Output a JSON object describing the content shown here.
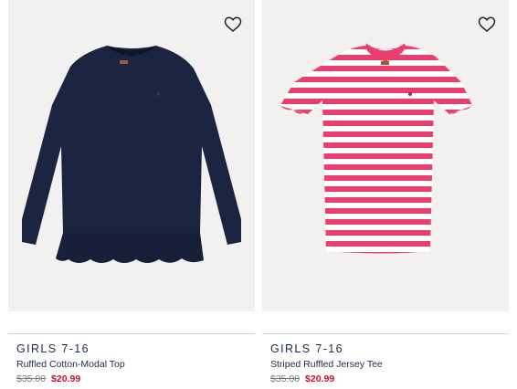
{
  "products": [
    {
      "category": "GIRLS 7-16",
      "name": "Ruffled Cotton-Modal Top",
      "original_price": "$35.00",
      "sale_price": "$20.99",
      "garment_color": "#1b2541",
      "icon": "heart-outline-icon"
    },
    {
      "category": "GIRLS 7-16",
      "name": "Striped Ruffled Jersey Tee",
      "original_price": "$35.00",
      "sale_price": "$20.99",
      "stripe_colors": [
        "#e83f6f",
        "#ffffff"
      ],
      "icon": "heart-outline-icon"
    }
  ],
  "colors": {
    "text": "#1d2b45",
    "sale": "#c8102e",
    "strike": "#7b7b7b",
    "image_bg": "#f2f1f0"
  }
}
